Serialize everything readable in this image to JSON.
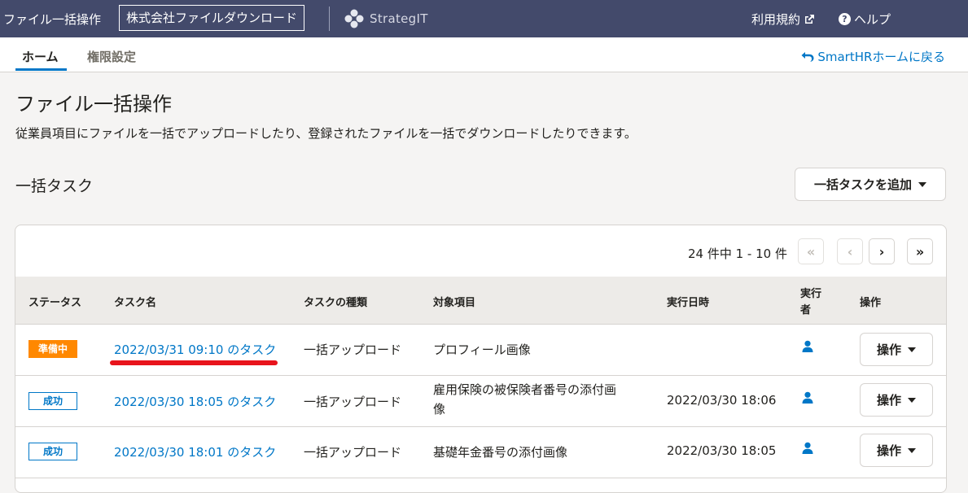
{
  "header": {
    "app_title": "ファイル一括操作",
    "company": "株式会社ファイルダウンロード",
    "brand": "StrategIT",
    "terms": "利用規約",
    "help": "ヘルプ"
  },
  "tabs": [
    {
      "label": "ホーム",
      "active": true
    },
    {
      "label": "権限設定",
      "active": false
    }
  ],
  "back_link": "SmartHRホームに戻る",
  "page": {
    "title": "ファイル一括操作",
    "description": "従業員項目にファイルを一括でアップロードしたり、登録されたファイルを一括でダウンロードしたりできます。"
  },
  "section": {
    "title": "一括タスク",
    "add_button": "一括タスクを追加"
  },
  "pagination": {
    "info": "24 件中 1 - 10 件",
    "first": "«",
    "prev": "‹",
    "next": "›",
    "last": "»"
  },
  "table": {
    "headers": {
      "status": "ステータス",
      "name": "タスク名",
      "type": "タスクの種類",
      "target": "対象項目",
      "executed_at": "実行日時",
      "executor_1": "実行",
      "executor_2": "者",
      "action": "操作"
    },
    "rows": [
      {
        "status": "準備中",
        "name": "2022/03/31 09:10 のタスク",
        "type": "一括アップロード",
        "target_1": "プロフィール画像",
        "target_2": "",
        "executed_at": "",
        "action": "操作"
      },
      {
        "status": "成功",
        "name": "2022/03/30 18:05 のタスク",
        "type": "一括アップロード",
        "target_1": "雇用保険の被保険者番号の添付画",
        "target_2": "像",
        "executed_at": "2022/03/30 18:06",
        "action": "操作"
      },
      {
        "status": "成功",
        "name": "2022/03/30 18:01 のタスク",
        "type": "一括アップロード",
        "target_1": "基礎年金番号の添付画像",
        "target_2": "",
        "executed_at": "2022/03/30 18:05",
        "action": "操作"
      }
    ]
  },
  "colors": {
    "header_bg": "#434a6b",
    "accent": "#0077c7",
    "status_preparing": "#ff8800",
    "annotation": "#e8141c"
  }
}
